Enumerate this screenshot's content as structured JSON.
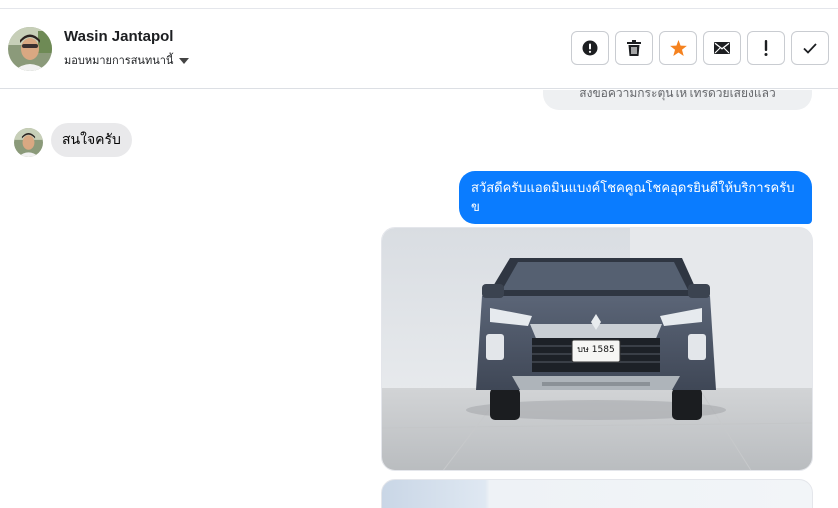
{
  "header": {
    "contact_name": "Wasin Jantapol",
    "assign_label": "มอบหมายการสนทนานี้",
    "actions": [
      {
        "name": "spam-button",
        "icon": "exclamation-circle-icon"
      },
      {
        "name": "delete-button",
        "icon": "trash-icon"
      },
      {
        "name": "star-button",
        "icon": "star-icon",
        "color": "#f5821f"
      },
      {
        "name": "mark-unread-button",
        "icon": "envelope-icon"
      },
      {
        "name": "follow-up-button",
        "icon": "exclamation-icon"
      },
      {
        "name": "mark-done-button",
        "icon": "check-icon"
      }
    ]
  },
  "messages": {
    "system_note": "ส่งข้อความกระตุ้นให้โทรด้วยเสียงแล้ว",
    "incoming_text": "สนใจครับ",
    "outgoing_text": "สวัสดีครับแอดมินแบงค์โชคคูณโชคอุดรยินดีให้บริการครับข",
    "license_plate": "บษ 1585"
  },
  "colors": {
    "accent_blue": "#0a7cff",
    "star_orange": "#f5821f",
    "bubble_gray": "#e9e9eb"
  }
}
